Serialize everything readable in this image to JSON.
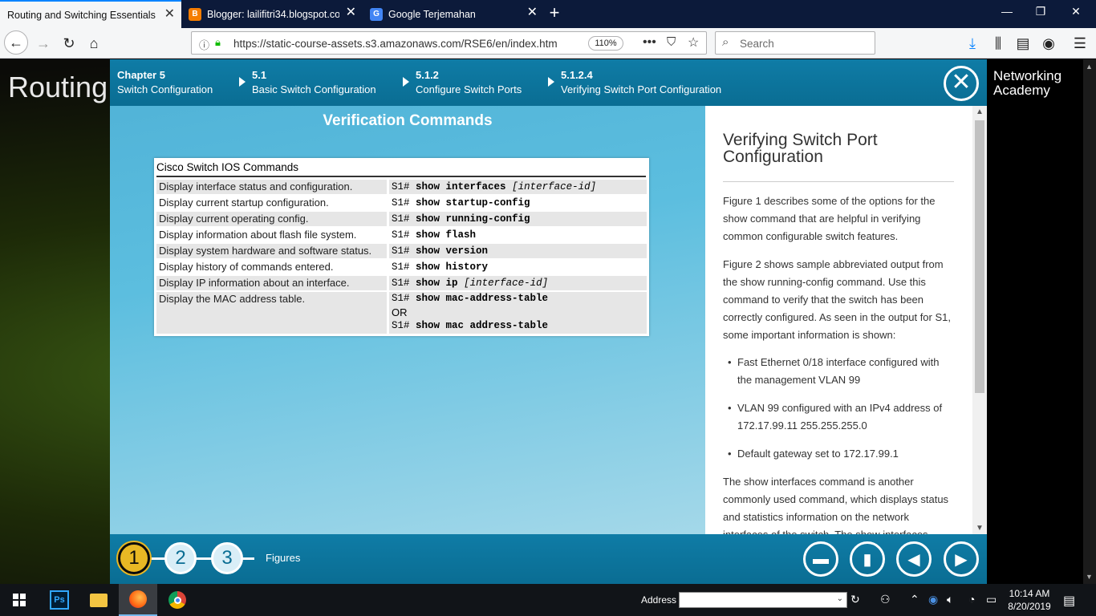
{
  "browser": {
    "tabs": [
      {
        "label": "Routing and Switching Essentials",
        "icon": "cisco-icon",
        "active": true
      },
      {
        "label": "Blogger: lailifitri34.blogspot.co",
        "icon": "blogger-icon",
        "active": false
      },
      {
        "label": "Google Terjemahan",
        "icon": "google-translate-icon",
        "active": false
      }
    ],
    "url": "https://static-course-assets.s3.amazonaws.com/RSE6/en/index.htm",
    "zoom": "110%",
    "search_placeholder": "Search"
  },
  "page": {
    "background_title": "Routing a",
    "brand": "Networking Academy",
    "breadcrumbs": [
      {
        "num": "Chapter 5",
        "text": "Switch Configuration"
      },
      {
        "num": "5.1",
        "text": "Basic Switch Configuration"
      },
      {
        "num": "5.1.2",
        "text": "Configure Switch Ports"
      },
      {
        "num": "5.1.2.4",
        "text": "Verifying Switch Port Configuration"
      }
    ],
    "figure": {
      "title": "Verification Commands",
      "table_header": "Cisco Switch IOS Commands",
      "rows": [
        {
          "desc": "Display interface status and configuration.",
          "prompt": "S1#",
          "cmd": "show interfaces",
          "arg": "[interface-id]"
        },
        {
          "desc": "Display current startup configuration.",
          "prompt": "S1#",
          "cmd": "show startup-config",
          "arg": ""
        },
        {
          "desc": "Display current operating config.",
          "prompt": "S1#",
          "cmd": "show running-config",
          "arg": ""
        },
        {
          "desc": "Display information about flash file system.",
          "prompt": "S1#",
          "cmd": "show flash",
          "arg": ""
        },
        {
          "desc": "Display system hardware and software status.",
          "prompt": "S1#",
          "cmd": "show version",
          "arg": ""
        },
        {
          "desc": "Display history of commands entered.",
          "prompt": "S1#",
          "cmd": "show history",
          "arg": ""
        },
        {
          "desc": "Display IP information about an interface.",
          "prompt": "S1#",
          "cmd": "show ip",
          "arg": "[interface-id]"
        },
        {
          "desc": "Display the MAC address table.",
          "prompt": "S1#",
          "cmd": "show mac-address-table",
          "arg": ""
        }
      ],
      "or_label": "OR",
      "alt_prompt": "S1#",
      "alt_cmd": "show mac address-table"
    },
    "text_panel": {
      "heading": "Verifying Switch Port Configuration",
      "p1": "Figure 1 describes some of the options for the show command that are helpful in verifying common configurable switch features.",
      "p2": "Figure 2 shows sample abbreviated output from the show running-config command. Use this command to verify that the switch has been correctly configured. As seen in the output for S1, some important information is shown:",
      "bullets": [
        "Fast Ethernet 0/18 interface configured with the management VLAN 99",
        "VLAN 99 configured with an IPv4 address of 172.17.99.11 255.255.255.0",
        "Default gateway set to 172.17.99.1"
      ],
      "p3": "The show interfaces command is another commonly used command, which displays status and statistics information on the network interfaces of the switch. The show interfaces"
    },
    "pager": {
      "pages": [
        "1",
        "2",
        "3"
      ],
      "current": "1",
      "label": "Figures"
    }
  },
  "taskbar": {
    "address_label": "Address",
    "time": "10:14 AM",
    "date": "8/20/2019"
  }
}
